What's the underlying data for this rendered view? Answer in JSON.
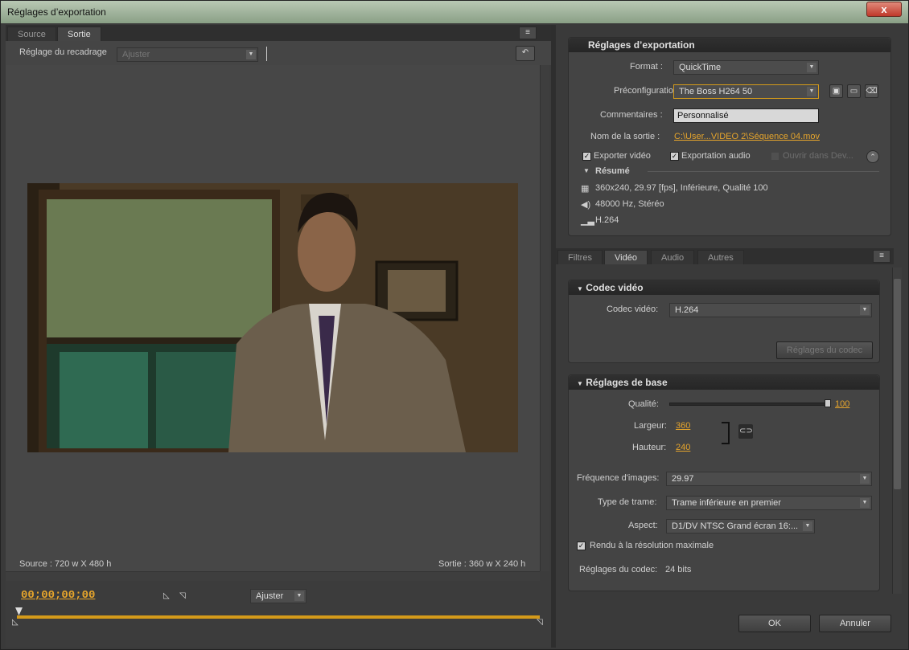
{
  "window": {
    "title": "Réglages d’exportation",
    "close": "x"
  },
  "left": {
    "tabs": [
      "Source",
      "Sortie"
    ],
    "crop_label": "Réglage du recadrage",
    "crop_value": "Ajuster",
    "source_info": "Source : 720 w X 480 h",
    "output_info": "Sortie : 360 w X 240 h",
    "timecode": "00;00;00;00",
    "fit_value": "Ajuster"
  },
  "export": {
    "header": "Réglages d’exportation",
    "format_label": "Format :",
    "format_value": "QuickTime",
    "preset_label": "Préconfiguration :",
    "preset_value": "The Boss H264 50",
    "comments_label": "Commentaires :",
    "comments_value": "Personnalisé",
    "output_label": "Nom de la sortie :",
    "output_value": "C:\\User...VIDEO 2\\Séquence 04.mov",
    "export_video": "Exporter vidéo",
    "export_audio": "Exportation audio",
    "open_in": "Ouvrir dans Dev...",
    "summary_label": "Résumé",
    "summary_video": "360x240, 29.97 [fps], Inférieure, Qualité 100",
    "summary_audio": "48000 Hz, Stéréo",
    "summary_codec": "H.264"
  },
  "tabs2": [
    "Filtres",
    "Vidéo",
    "Audio",
    "Autres"
  ],
  "codec": {
    "header": "Codec vidéo",
    "label": "Codec vidéo:",
    "value": "H.264",
    "settings_button": "Réglages du codec"
  },
  "basic": {
    "header": "Réglages de base",
    "quality_label": "Qualité:",
    "quality_value": "100",
    "quality_level": 1.0,
    "width_label": "Largeur:",
    "width_value": "360",
    "height_label": "Hauteur:",
    "height_value": "240",
    "fps_label": "Fréquence d'images:",
    "fps_value": "29.97",
    "field_label": "Type de trame:",
    "field_value": "Trame inférieure en premier",
    "aspect_label": "Aspect:",
    "aspect_value": "D1/DV NTSC Grand écran 16:...",
    "max_render": "Rendu à la résolution maximale",
    "codec_settings_label": "Réglages du codec:",
    "codec_settings_value": "24 bits"
  },
  "buttons": {
    "ok": "OK",
    "cancel": "Annuler"
  }
}
